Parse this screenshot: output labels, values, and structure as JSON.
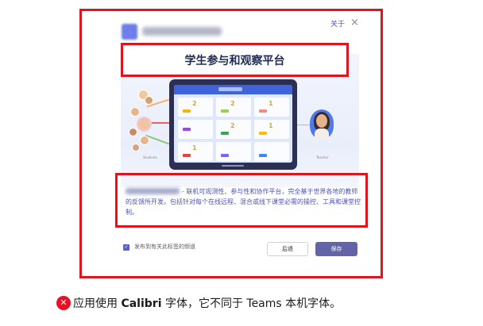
{
  "dialog": {
    "about_label": "关于",
    "close_glyph": "×",
    "title": "学生参与和观察平台",
    "description_body": "- 联机可观测性、参与性和协作平台，完全基于世界各地的教师的反馈所开发。包括针对每个在线远程、混合或线下课堂必需的操控、工具和课堂控制。",
    "students_caption": "Students",
    "teacher_caption": "Teacher",
    "tablet_cell_numbers": [
      "2",
      "2",
      "1",
      "2",
      "1",
      "1"
    ],
    "publish_checkbox_label": "发布到有关此标签的频道",
    "publish_checked": true,
    "back_label": "后退",
    "save_label": "保存",
    "accent_color": "#6264a7",
    "annotation_color": "#e0141c"
  },
  "caption": {
    "icon": "error-x-icon",
    "text_before": "应用使用 ",
    "font_name": "Calibri",
    "text_after": " 字体，它不同于 Teams 本机字体。"
  }
}
